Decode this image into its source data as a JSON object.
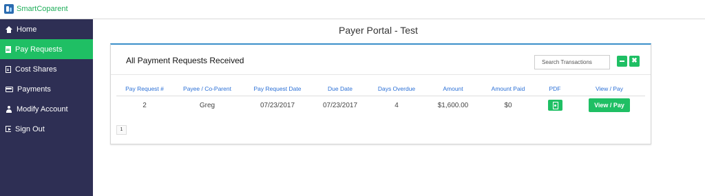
{
  "brand": {
    "name": "SmartCoparent"
  },
  "sidebar": {
    "items": [
      {
        "label": "Home",
        "icon": "home-icon",
        "active": false
      },
      {
        "label": "Pay Requests",
        "icon": "document-icon",
        "active": true
      },
      {
        "label": "Cost Shares",
        "icon": "list-document-icon",
        "active": false
      },
      {
        "label": "Payments",
        "icon": "credit-card-icon",
        "active": false
      },
      {
        "label": "Modify Account",
        "icon": "user-icon",
        "active": false
      },
      {
        "label": "Sign Out",
        "icon": "sign-out-icon",
        "active": false
      }
    ]
  },
  "page": {
    "title": "Payer Portal - Test"
  },
  "panel": {
    "title": "All Payment Requests Received",
    "search_placeholder": "Search Transactions",
    "minimize_icon": "minus-icon",
    "close_label": "✖"
  },
  "table": {
    "columns": [
      "Pay Request #",
      "Payee / Co-Parent",
      "Pay Request Date",
      "Due Date",
      "Days Overdue",
      "Amount",
      "Amount Paid",
      "PDF",
      "View / Pay"
    ],
    "rows": [
      {
        "request_no": "2",
        "payee": "Greg",
        "request_date": "07/23/2017",
        "due_date": "07/23/2017",
        "days_overdue": "4",
        "amount": "$1,600.00",
        "amount_paid": "$0",
        "pdf_icon": "pdf-icon",
        "view_label": "View / Pay"
      }
    ]
  },
  "pagination": {
    "current": "1"
  },
  "colors": {
    "accent": "#1fbf64",
    "sidebar_bg": "#2e2f54",
    "header_blue": "#2a6fd6",
    "panel_top": "#3a8fc9"
  }
}
